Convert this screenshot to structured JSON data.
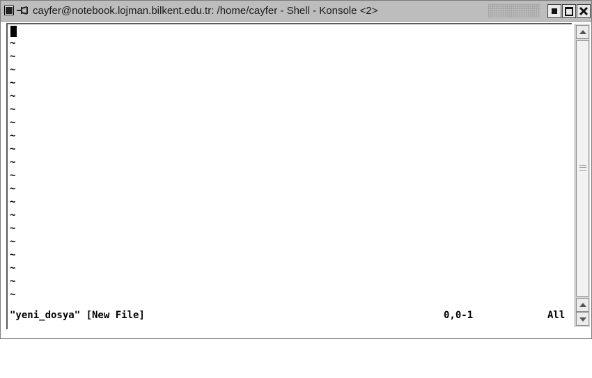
{
  "window": {
    "title": "cayfer@notebook.lojman.bilkent.edu.tr: /home/cayfer - Shell - Konsole <2>",
    "icons": [
      "window-menu-icon",
      "pin-icon",
      "minimize-icon",
      "maximize-icon",
      "close-icon"
    ]
  },
  "editor": {
    "empty_line_marker": "~",
    "empty_line_count": 20,
    "status": {
      "file": "\"yeni_dosya\" [New File]",
      "position": "0,0-1",
      "scroll": "All"
    }
  },
  "colors": {
    "titlebar": "#bdbdbd",
    "background": "#ffffff",
    "text": "#000000"
  }
}
